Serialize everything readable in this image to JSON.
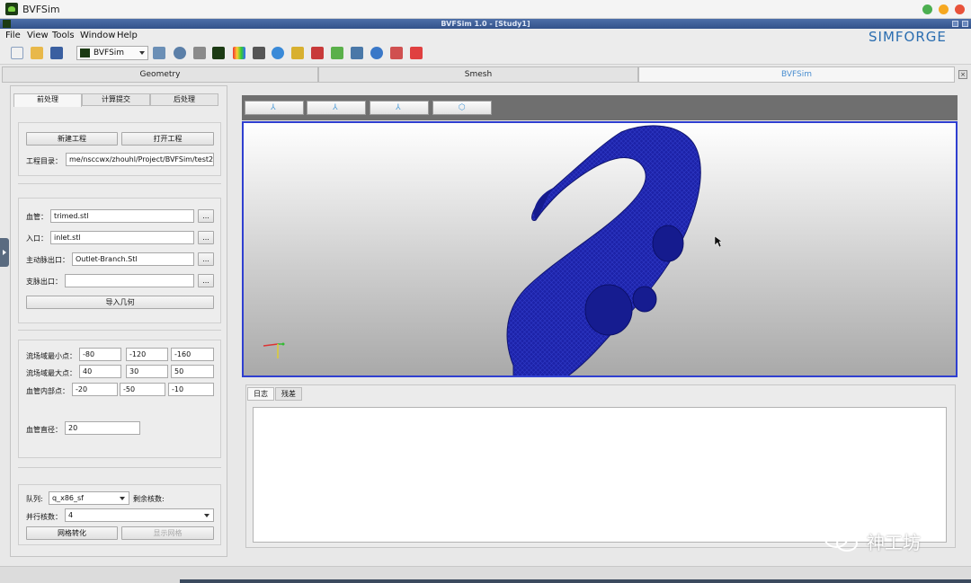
{
  "window": {
    "title": "BVFSim"
  },
  "app": {
    "title": "BVFSim 1.0 - [Study1]",
    "brand": "SIMFORGE"
  },
  "menu": [
    "File",
    "View",
    "Tools",
    "Window",
    "Help"
  ],
  "toolbar": {
    "module": "BVFSim"
  },
  "main_tabs": [
    "Geometry",
    "Smesh",
    "BVFSim"
  ],
  "sub_tabs": [
    "前处理",
    "计算提交",
    "后处理"
  ],
  "project": {
    "new_label": "新建工程",
    "open_label": "打开工程",
    "dir_label": "工程目录：",
    "dir_value": "me/nsccwx/zhouhl/Project/BVFSim/test2"
  },
  "geometry": {
    "vessel_label": "血管：",
    "vessel_value": "trimed.stl",
    "inlet_label": "入口：",
    "inlet_value": "inlet.stl",
    "aorta_label": "主动脉出口：",
    "aorta_value": "Outlet-Branch.Stl",
    "branch_label": "支脉出口：",
    "branch_value": "",
    "browse": "...",
    "import_label": "导入几何"
  },
  "domain": {
    "min_label": "流场域最小点：",
    "min_values": [
      "-80",
      "-120",
      "-160"
    ],
    "max_label": "流场域最大点：",
    "max_values": [
      "40",
      "30",
      "50"
    ],
    "inner_label": "血管内部点：",
    "inner_values": [
      "-20",
      "-50",
      "-10"
    ],
    "diameter_label": "血管直径：",
    "diameter_value": "20"
  },
  "queue": {
    "queue_label": "队列:",
    "queue_value": "q_x86_sf",
    "remaining_label": "剩余核数:",
    "cores_label": "并行核数：",
    "cores_value": "4",
    "convert_label": "网格转化",
    "show_label": "显示网格"
  },
  "log_tabs": [
    "日志",
    "残差"
  ],
  "watermark": "神工坊",
  "colors": {
    "accent": "#4a8ed0",
    "mesh": "#1a1f9e",
    "viewport_border": "#2f3fd0"
  }
}
